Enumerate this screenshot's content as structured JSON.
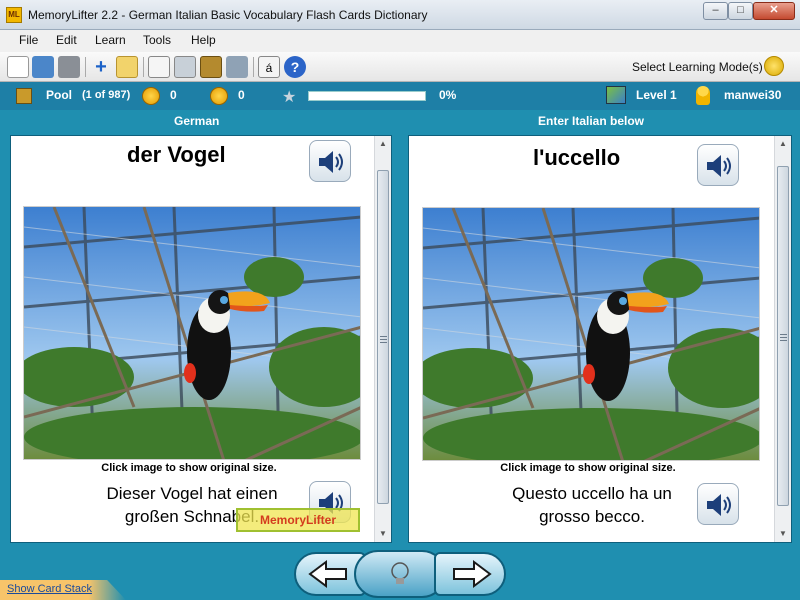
{
  "window": {
    "title": "MemoryLifter 2.2 - German Italian Basic Vocabulary Flash Cards Dictionary",
    "app_icon_text": "ML",
    "minimize": "–",
    "maximize": "□",
    "close": "✕"
  },
  "menu": [
    "File",
    "Edit",
    "Learn",
    "Tools",
    "Help"
  ],
  "toolbar": {
    "icons": [
      "new-file-icon",
      "open-folder-icon",
      "print-icon",
      "add-card-icon",
      "edit-card-icon",
      "presentation-icon",
      "statistics-icon",
      "card-box-icon",
      "settings-tools-icon",
      "special-char-icon",
      "help-icon"
    ],
    "special_char": "á",
    "help": "?",
    "plus": "+",
    "learning_mode_label": "Select Learning Mode(s)"
  },
  "stats": {
    "pool_label": "Pool",
    "pool_count": "(1 of 987)",
    "correct_count": "0",
    "wrong_count": "0",
    "progress_text": "0%",
    "progress_fraction": 0,
    "level": "Level 1",
    "user": "manwei30"
  },
  "left_card": {
    "header": "German",
    "word": "der Vogel",
    "note": "Click image to show original size.",
    "sentence_line1": "Dieser Vogel hat einen",
    "sentence_line2": "großen Schnabel."
  },
  "right_card": {
    "header": "Enter Italian below",
    "word": "l'uccello",
    "note": "Click image to show original size.",
    "sentence_line1": "Questo uccello ha un",
    "sentence_line2": "grosso becco."
  },
  "watermark": "MemoryLifter",
  "footer": {
    "show_card_stack": "Show Card Stack"
  },
  "colors": {
    "accent": "#1f8fb0",
    "stats_bar": "#1e7fa6",
    "progress_fill": "#3cb04c",
    "link": "#1b4a9a"
  }
}
